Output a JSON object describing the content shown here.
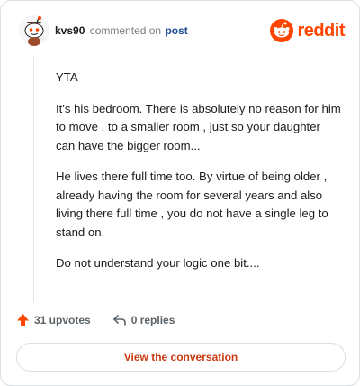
{
  "comment": {
    "username": "kvs90",
    "action_text": "commented on",
    "post_link_text": "post",
    "paragraphs": [
      "YTA",
      "It's his bedroom. There is absolutely no reason for him to move , to a smaller room , just so your daughter can have the bigger room...",
      "He lives there full time too. By virtue of being older , already having the room for several years and also living there full time , you do not have a single leg to stand on.",
      "Do not understand your logic one bit...."
    ]
  },
  "brand": {
    "wordmark": "reddit",
    "color": "#ff4500",
    "icon": "reddit-logo-icon"
  },
  "stats": {
    "upvotes": "31 upvotes",
    "replies": "0 replies",
    "upvote_color": "#ff4500"
  },
  "cta": {
    "label": "View the conversation"
  }
}
